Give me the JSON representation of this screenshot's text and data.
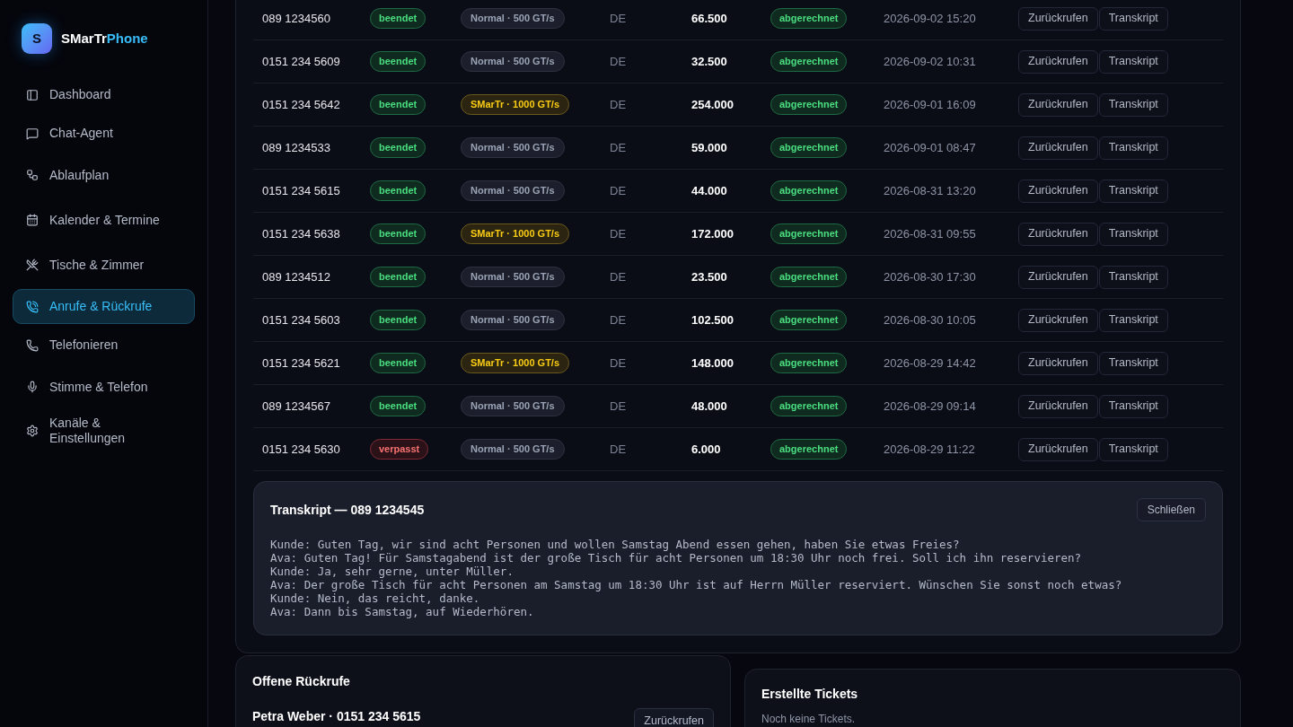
{
  "brand": {
    "logo_letter": "S",
    "name_a": "SMarTr",
    "name_b": "Phone"
  },
  "sidebar": {
    "items": [
      {
        "label": "Dashboard",
        "selected": false
      },
      {
        "label": "Chat-Agent",
        "selected": false
      },
      {
        "label": "Ablaufplan",
        "selected": false
      },
      {
        "label": "Kalender & Termine",
        "selected": false
      },
      {
        "label": "Tische & Zimmer",
        "selected": false
      },
      {
        "label": "Anrufe & Rückrufe",
        "selected": true
      },
      {
        "label": "Telefonieren",
        "selected": false
      },
      {
        "label": "Stimme & Telefon",
        "selected": false
      },
      {
        "label": "Kanäle & Einstellungen",
        "selected": false
      }
    ]
  },
  "calls": {
    "rows": [
      {
        "number": "089 1234560",
        "status": {
          "text": "beendet",
          "kind": "ok"
        },
        "tier": {
          "text": "Normal · 500 GT/s",
          "kind": "normal"
        },
        "country": "DE",
        "tokens": "66.500",
        "billing": "abgerechnet",
        "time": "2026-09-02 15:20",
        "actions": [
          "Zurückrufen",
          "Transkript"
        ]
      },
      {
        "number": "0151 234 5609",
        "status": {
          "text": "beendet",
          "kind": "ok"
        },
        "tier": {
          "text": "Normal · 500 GT/s",
          "kind": "normal"
        },
        "country": "DE",
        "tokens": "32.500",
        "billing": "abgerechnet",
        "time": "2026-09-02 10:31",
        "actions": [
          "Zurückrufen",
          "Transkript"
        ]
      },
      {
        "number": "0151 234 5642",
        "status": {
          "text": "beendet",
          "kind": "ok"
        },
        "tier": {
          "text": "SMarTr · 1000 GT/s",
          "kind": "premium"
        },
        "country": "DE",
        "tokens": "254.000",
        "billing": "abgerechnet",
        "time": "2026-09-01 16:09",
        "actions": [
          "Zurückrufen",
          "Transkript"
        ]
      },
      {
        "number": "089 1234533",
        "status": {
          "text": "beendet",
          "kind": "ok"
        },
        "tier": {
          "text": "Normal · 500 GT/s",
          "kind": "normal"
        },
        "country": "DE",
        "tokens": "59.000",
        "billing": "abgerechnet",
        "time": "2026-09-01 08:47",
        "actions": [
          "Zurückrufen",
          "Transkript"
        ]
      },
      {
        "number": "0151 234 5615",
        "status": {
          "text": "beendet",
          "kind": "ok"
        },
        "tier": {
          "text": "Normal · 500 GT/s",
          "kind": "normal"
        },
        "country": "DE",
        "tokens": "44.000",
        "billing": "abgerechnet",
        "time": "2026-08-31 13:20",
        "actions": [
          "Zurückrufen",
          "Transkript"
        ]
      },
      {
        "number": "0151 234 5638",
        "status": {
          "text": "beendet",
          "kind": "ok"
        },
        "tier": {
          "text": "SMarTr · 1000 GT/s",
          "kind": "premium"
        },
        "country": "DE",
        "tokens": "172.000",
        "billing": "abgerechnet",
        "time": "2026-08-31 09:55",
        "actions": [
          "Zurückrufen",
          "Transkript"
        ]
      },
      {
        "number": "089 1234512",
        "status": {
          "text": "beendet",
          "kind": "ok"
        },
        "tier": {
          "text": "Normal · 500 GT/s",
          "kind": "normal"
        },
        "country": "DE",
        "tokens": "23.500",
        "billing": "abgerechnet",
        "time": "2026-08-30 17:30",
        "actions": [
          "Zurückrufen",
          "Transkript"
        ]
      },
      {
        "number": "0151 234 5603",
        "status": {
          "text": "beendet",
          "kind": "ok"
        },
        "tier": {
          "text": "Normal · 500 GT/s",
          "kind": "normal"
        },
        "country": "DE",
        "tokens": "102.500",
        "billing": "abgerechnet",
        "time": "2026-08-30 10:05",
        "actions": [
          "Zurückrufen",
          "Transkript"
        ]
      },
      {
        "number": "0151 234 5621",
        "status": {
          "text": "beendet",
          "kind": "ok"
        },
        "tier": {
          "text": "SMarTr · 1000 GT/s",
          "kind": "premium"
        },
        "country": "DE",
        "tokens": "148.000",
        "billing": "abgerechnet",
        "time": "2026-08-29 14:42",
        "actions": [
          "Zurückrufen",
          "Transkript"
        ]
      },
      {
        "number": "089 1234567",
        "status": {
          "text": "beendet",
          "kind": "ok"
        },
        "tier": {
          "text": "Normal · 500 GT/s",
          "kind": "normal"
        },
        "country": "DE",
        "tokens": "48.000",
        "billing": "abgerechnet",
        "time": "2026-08-29 09:14",
        "actions": [
          "Zurückrufen",
          "Transkript"
        ]
      },
      {
        "number": "0151 234 5630",
        "status": {
          "text": "verpasst",
          "kind": "missed"
        },
        "tier": {
          "text": "Normal · 500 GT/s",
          "kind": "normal"
        },
        "country": "DE",
        "tokens": "6.000",
        "billing": "abgerechnet",
        "time": "2026-08-29 11:22",
        "actions": [
          "Zurückrufen",
          "Transkript"
        ]
      }
    ],
    "transcript": {
      "title": "Transkript — 089 1234545",
      "close": "Schließen",
      "lines": [
        "Kunde: Guten Tag, wir sind acht Personen und wollen Samstag Abend essen gehen, haben Sie etwas Freies?",
        "Ava: Guten Tag! Für Samstagabend ist der große Tisch für acht Personen um 18:30 Uhr noch frei. Soll ich ihn reservieren?",
        "Kunde: Ja, sehr gerne, unter Müller.",
        "Ava: Der große Tisch für acht Personen am Samstag um 18:30 Uhr ist auf Herrn Müller reserviert. Wünschen Sie sonst noch etwas?",
        "Kunde: Nein, das reicht, danke.",
        "Ava: Dann bis Samstag, auf Wiederhören."
      ]
    }
  },
  "callbacks": {
    "title": "Offene Rückrufe",
    "items": [
      {
        "name": "Petra Weber · 0151 234 5615",
        "action": "Zurückrufen"
      }
    ]
  },
  "tickets": {
    "title": "Erstellte Tickets",
    "empty": "Noch keine Tickets."
  }
}
